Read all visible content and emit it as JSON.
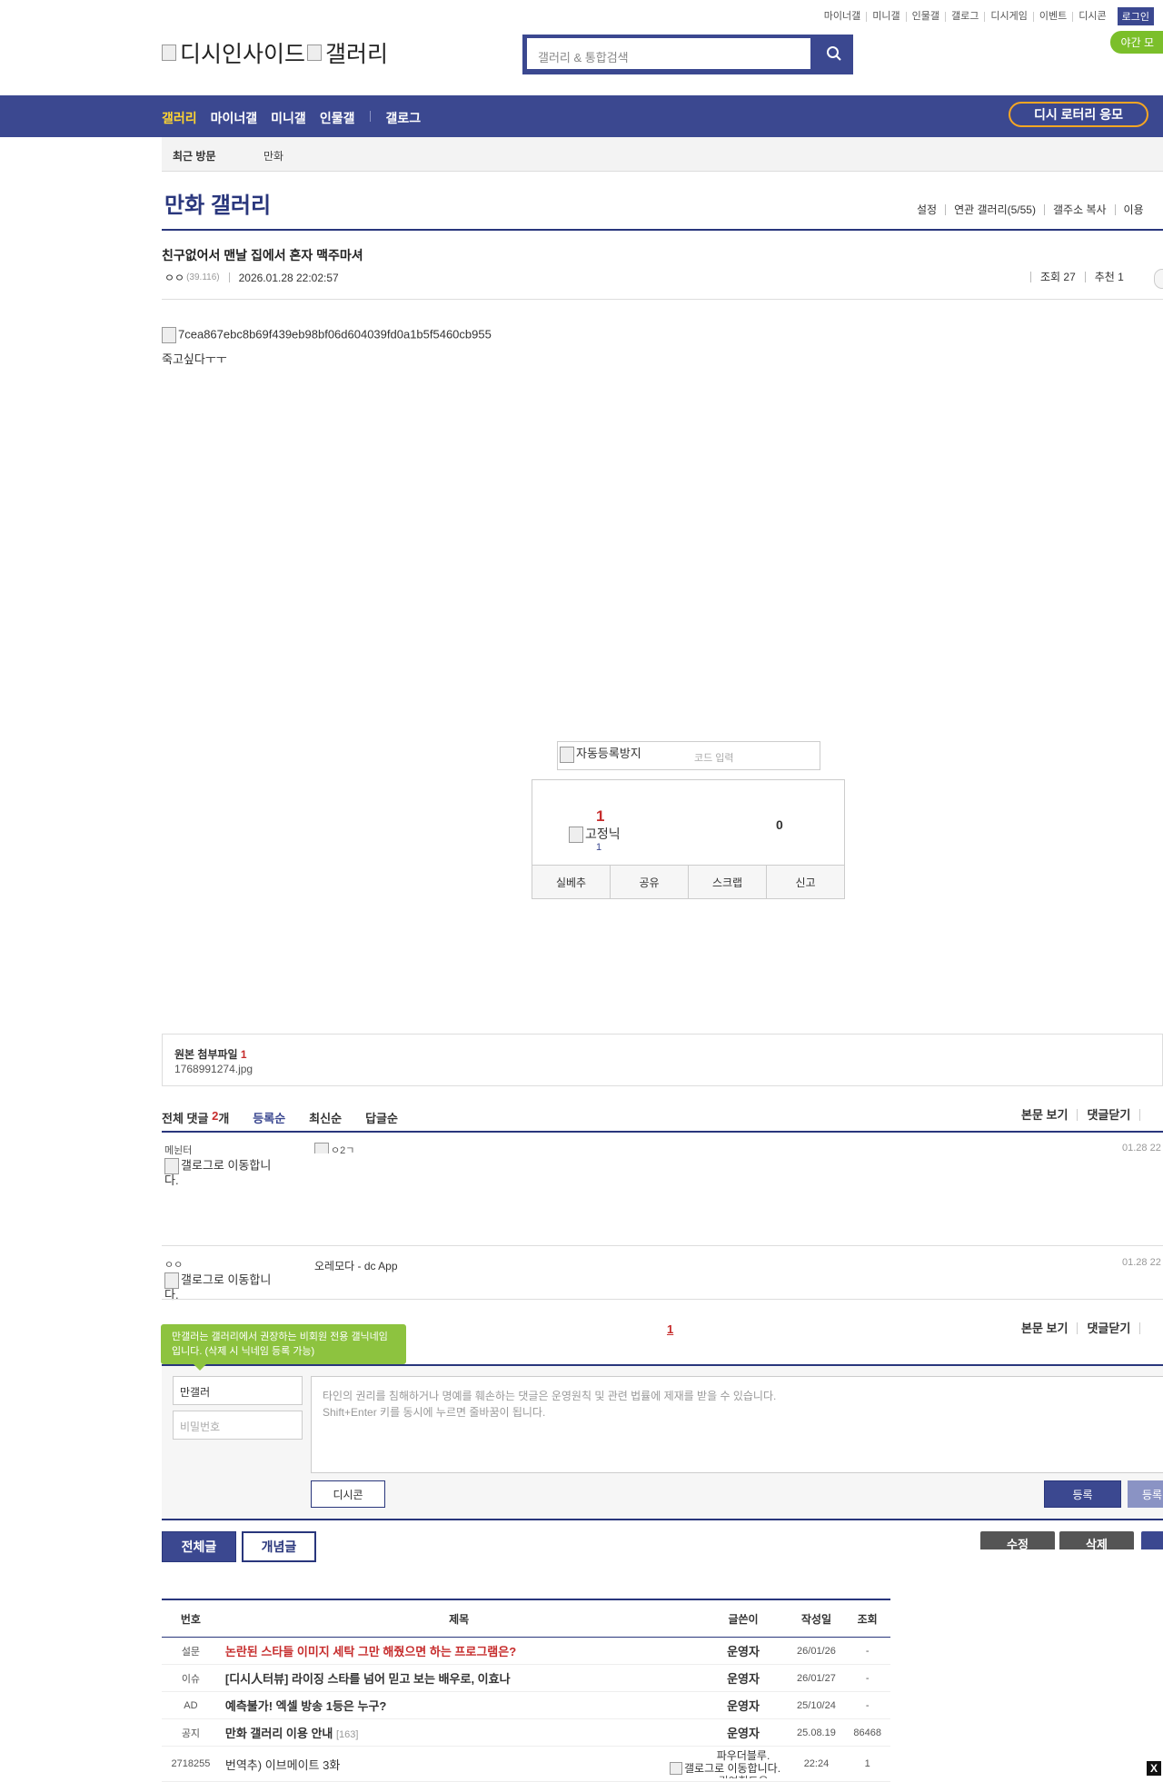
{
  "topnav": [
    "마이너갤",
    "미니갤",
    "인물갤",
    "갤로그",
    "디시게임",
    "이벤트",
    "디시콘"
  ],
  "login_label": "로그인",
  "night_mode_label": "야간 모",
  "logo": {
    "alt1": "디시인사이드",
    "alt2": "갤러리"
  },
  "search": {
    "placeholder": "갤러리 & 통합검색",
    "icon": "search-icon"
  },
  "gnb": {
    "items": [
      "갤러리",
      "마이너갤",
      "미니갤",
      "인물갤"
    ],
    "extra": "갤로그",
    "lottery": "디시 로터리 응모"
  },
  "recent_visit": {
    "label": "최근 방문",
    "gallery": "만화"
  },
  "gallery": {
    "title": "만화 갤러리",
    "menu": [
      "설정",
      "연관 갤러리(5/55)",
      "갤주소 복사",
      "이용"
    ]
  },
  "post": {
    "title": "친구없어서 맨날 집에서 혼자 맥주마셔",
    "nick": "ㅇㅇ",
    "ip": "(39.116)",
    "date": "2026.01.28 22:02:57",
    "views": "조회 27",
    "recommend": "추천 1",
    "image_alt": "7cea867ebc8b69f439eb98bf06d604039fd0a1b5f5460cb955",
    "body": "죽고싶다ㅜㅜ"
  },
  "captcha": {
    "alt": "자동등록방지",
    "placeholder": "코드 입력"
  },
  "recommend_box": {
    "up_count": "1",
    "fixed_nick_alt": "고정닉",
    "fixed_count": "1",
    "down_count": "0",
    "buttons": [
      "실베추",
      "공유",
      "스크랩",
      "신고"
    ]
  },
  "attachments": {
    "label": "원본 첨부파일",
    "count": "1",
    "file": "1768991274.jpg"
  },
  "comments": {
    "label": "전체 댓글",
    "count": "2",
    "unit": "개",
    "sorts": [
      "등록순",
      "최신순",
      "답글순"
    ],
    "actions": [
      "본문 보기",
      "댓글닫기"
    ],
    "items": [
      {
        "nick": "메뉜터",
        "gallog_alt": "갤로그로 이동합니다.",
        "content_alt": "ㅇ2ㄱ",
        "date": "01.28 22"
      },
      {
        "nick": "ㅇㅇ",
        "gallog_alt": "갤로그로 이동합니다.",
        "content": "오레모다 - dc App",
        "date": "01.28 22"
      }
    ],
    "page": "1"
  },
  "write": {
    "tooltip": "만갤러는 갤러리에서 권장하는 비회원 전용 갤닉네임입니다. (삭제 시 닉네임 등록 가능)",
    "nick_value": "만갤러",
    "password_placeholder": "비밀번호",
    "textarea_line1": "타인의 권리를 침해하거나 명예를 훼손하는 댓글은 운영원칙 및 관련 법률에 제재를 받을 수 있습니다.",
    "textarea_line2": "Shift+Enter 키를 동시에 누르면 줄바꿈이 됩니다.",
    "dccon_label": "디시콘",
    "submit_label": "등록",
    "submit2_label": "등록"
  },
  "list_buttons": {
    "all": "전체글",
    "concept": "개념글",
    "edit": "수정",
    "delete": "삭제"
  },
  "table": {
    "headers": [
      "번호",
      "제목",
      "글쓴이",
      "작성일",
      "조회"
    ],
    "rows": [
      {
        "num": "설문",
        "title": "논란된 스타들 이미지 세탁 그만 해줬으면 하는 프로그램은?",
        "writer": "운영자",
        "date": "26/01/26",
        "views": "-",
        "style": "red"
      },
      {
        "num": "이슈",
        "title": "[디시人터뷰] 라이징 스타를 넘어 믿고 보는 배우로, 이효나",
        "writer": "운영자",
        "date": "26/01/27",
        "views": "-",
        "style": "bold"
      },
      {
        "num": "AD",
        "title": "예측불가! 엑셀 방송 1등은 누구?",
        "writer": "운영자",
        "date": "25/10/24",
        "views": "-",
        "style": "bold"
      },
      {
        "num": "공지",
        "title": "만화 갤러리 이용 안내",
        "reply": "[163]",
        "writer": "운영자",
        "date": "25.08.19",
        "views": "86468",
        "style": "bold"
      },
      {
        "num": "2718255",
        "title": "번역추) 이브메이트 3화",
        "writer_nick": "파우더블루.",
        "writer_alt": "갤로그로 이동합니다.",
        "writer_extra": "귀여힐도우",
        "date": "22:24",
        "views": "1",
        "style": "norm"
      }
    ]
  },
  "close_label": "X"
}
